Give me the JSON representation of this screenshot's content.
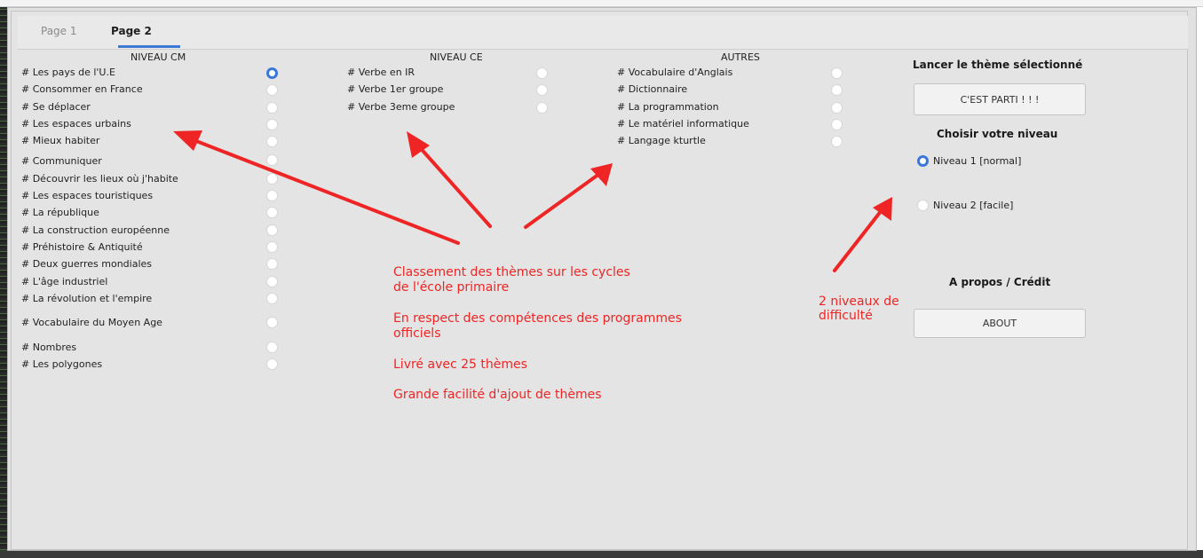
{
  "tabs": [
    {
      "label": "Page 1",
      "active": false
    },
    {
      "label": "Page 2",
      "active": true
    }
  ],
  "columns": {
    "cm": {
      "header": "NIVEAU CM",
      "items": [
        {
          "label": "# Les pays de l'U.E",
          "checked": true
        },
        {
          "label": "# Consommer en France",
          "checked": false
        },
        {
          "label": "# Se déplacer",
          "checked": false
        },
        {
          "label": "# Les espaces urbains",
          "checked": false
        },
        {
          "label": "# Mieux habiter",
          "checked": false
        },
        {
          "label": "# Communiquer",
          "checked": false
        },
        {
          "label": "# Découvrir les  lieux où j'habite",
          "checked": false
        },
        {
          "label": "# Les espaces touristiques",
          "checked": false
        },
        {
          "label": "# La république",
          "checked": false
        },
        {
          "label": "# La construction européenne",
          "checked": false
        },
        {
          "label": "# Préhistoire & Antiquité",
          "checked": false
        },
        {
          "label": "# Deux guerres mondiales",
          "checked": false
        },
        {
          "label": "# L'âge industriel",
          "checked": false
        },
        {
          "label": "# La révolution et l'empire",
          "checked": false
        },
        {
          "label": "# Vocabulaire du Moyen Age",
          "checked": false
        },
        {
          "label": "# Nombres",
          "checked": false
        },
        {
          "label": "# Les polygones",
          "checked": false
        }
      ]
    },
    "ce": {
      "header": "NIVEAU CE",
      "items": [
        {
          "label": "# Verbe en IR",
          "checked": false
        },
        {
          "label": "# Verbe 1er groupe",
          "checked": false
        },
        {
          "label": "# Verbe 3eme groupe",
          "checked": false
        }
      ]
    },
    "autres": {
      "header": "AUTRES",
      "items": [
        {
          "label": "# Vocabulaire d'Anglais",
          "checked": false
        },
        {
          "label": "# Dictionnaire",
          "checked": false
        },
        {
          "label": "# La programmation",
          "checked": false
        },
        {
          "label": "# Le matériel informatique",
          "checked": false
        },
        {
          "label": "# Langage kturtle",
          "checked": false
        }
      ]
    }
  },
  "right_panel": {
    "launch_title": "Lancer le thème sélectionné",
    "launch_button": "C'EST PARTI ! ! !",
    "level_title": "Choisir votre niveau",
    "levels": [
      {
        "label": "Niveau 1 [normal]",
        "checked": true
      },
      {
        "label": "Niveau 2 [facile]",
        "checked": false
      }
    ],
    "about_title": "A propos / Crédit",
    "about_button": "ABOUT"
  },
  "annotations": {
    "line1": "Classement des thèmes sur les cycles",
    "line2": "de l'école primaire",
    "line3": "En respect des compétences des programmes",
    "line4": "officiels",
    "line5": "Livré avec 25 thèmes",
    "line6": "Grande facilité d'ajout de thèmes",
    "levels_note_1": "2 niveaux de",
    "levels_note_2": "difficulté"
  },
  "colors": {
    "accent": "#3978d8",
    "annotation": "#ef2525"
  }
}
